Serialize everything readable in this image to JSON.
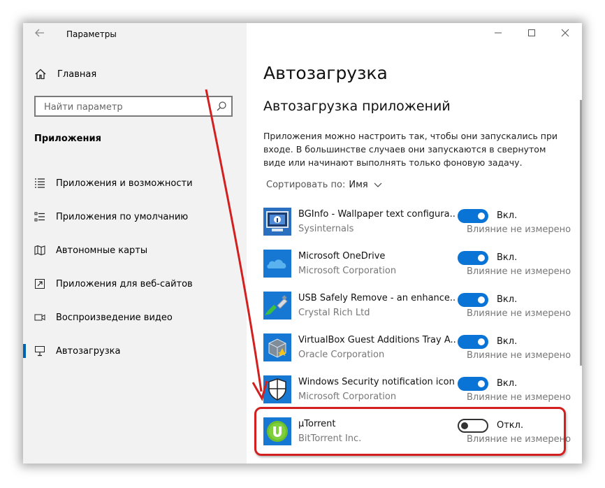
{
  "window": {
    "title": "Параметры",
    "back_icon": "back-arrow-icon",
    "min_icon": "minimize-icon",
    "max_icon": "maximize-icon",
    "close_icon": "close-icon"
  },
  "sidebar": {
    "home_label": "Главная",
    "search_placeholder": "Найти параметр",
    "section_title": "Приложения",
    "items": [
      {
        "label": "Приложения и возможности",
        "icon": "apps-features-icon"
      },
      {
        "label": "Приложения по умолчанию",
        "icon": "default-apps-icon"
      },
      {
        "label": "Автономные карты",
        "icon": "offline-maps-icon"
      },
      {
        "label": "Приложения для веб-сайтов",
        "icon": "apps-for-websites-icon"
      },
      {
        "label": "Воспроизведение видео",
        "icon": "video-playback-icon"
      },
      {
        "label": "Автозагрузка",
        "icon": "startup-icon",
        "active": true
      }
    ]
  },
  "main": {
    "page_title": "Автозагрузка",
    "section_title": "Автозагрузка приложений",
    "description": "Приложения можно настроить так, чтобы они запускались при входе. В большинстве случаев они запускаются в свернутом виде или начинают выполнять только фоновую задачу.",
    "sort_label": "Сортировать по:",
    "sort_value": "Имя",
    "apps": [
      {
        "name": "BGInfo - Wallpaper text configura...",
        "publisher": "Sysinternals",
        "state": "Вкл.",
        "on": true,
        "impact": "Влияние не измерено",
        "icon": "bginfo-icon"
      },
      {
        "name": "Microsoft OneDrive",
        "publisher": "Microsoft Corporation",
        "state": "Вкл.",
        "on": true,
        "impact": "Влияние не измерено",
        "icon": "onedrive-icon"
      },
      {
        "name": "USB Safely Remove - an enhance...",
        "publisher": "Crystal Rich Ltd",
        "state": "Вкл.",
        "on": true,
        "impact": "Влияние не измерено",
        "icon": "usb-safely-remove-icon"
      },
      {
        "name": "VirtualBox Guest Additions Tray A...",
        "publisher": "Oracle Corporation",
        "state": "Вкл.",
        "on": true,
        "impact": "Влияние не измерено",
        "icon": "virtualbox-icon"
      },
      {
        "name": "Windows Security notification icon",
        "publisher": "Microsoft Corporation",
        "state": "Вкл.",
        "on": true,
        "impact": "Влияние не измерено",
        "icon": "windows-security-icon"
      },
      {
        "name": "µTorrent",
        "publisher": "BitTorrent Inc.",
        "state": "Откл.",
        "on": false,
        "impact": "Влияние не измерено",
        "icon": "utorrent-icon"
      }
    ]
  },
  "colors": {
    "accent": "#0a74d6",
    "annotation": "#d21f1f"
  }
}
